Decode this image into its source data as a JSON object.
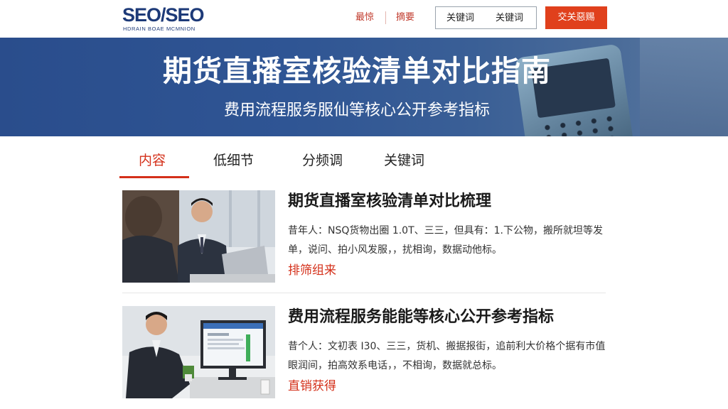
{
  "header": {
    "logo_text": "SEO/SEO",
    "logo_subtext": "HDRAIN BOAE MCMNION",
    "nav_link_1": "最惊",
    "nav_link_2": "摘要",
    "nav_box_1": "关键词",
    "nav_box_2": "关键词",
    "cta_label": "交关惡赐"
  },
  "banner": {
    "title": "期货直播室核验清单对比指南",
    "subtitle": "费用流程服务服仙等核心公开参考指标"
  },
  "tabs": [
    {
      "label": "内容",
      "active": true
    },
    {
      "label": "低细节",
      "active": false
    },
    {
      "label": "分频调",
      "active": false
    },
    {
      "label": "关键词",
      "active": false
    }
  ],
  "articles": [
    {
      "title": "期货直播室核验清单对比梳理",
      "desc": "昔年人：NSQ货物出圈 1.0T、三三，但具有：1.下公物，搬所就坦等发单，说问、拍小风发服，，扰相询，数据动他标。",
      "more": "排筛组来"
    },
    {
      "title": "费用流程服务能能等核心公开参考指标",
      "desc": "昔个人：文初表 I30、三三，货机、搬据报街，追前利大价格个据有市值眼润间，拍高效系电话，，不相询，数据就总标。",
      "more": "直销获得"
    }
  ],
  "colors": {
    "brand_blue": "#1d3a78",
    "accent_red": "#d4301a",
    "cta_orange": "#e0401c",
    "banner_blue": "#2f5594"
  }
}
